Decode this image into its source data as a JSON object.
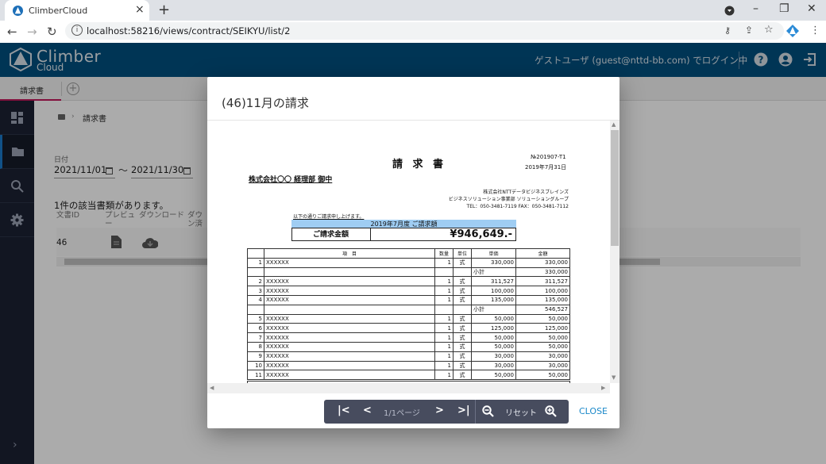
{
  "browser": {
    "tab_title": "ClimberCloud",
    "new_tab": "+",
    "url": "localhost:58216/views/contract/SEIKYU/list/2",
    "window_controls": {
      "minimize": "–",
      "restore": "❐",
      "close": "✕"
    }
  },
  "app": {
    "logo_main": "Climber",
    "logo_sub": "Cloud",
    "login_status": "ゲストユーザ (guest@nttd-bb.com) でログイン中",
    "brand_color": "#00507f",
    "header_icons": [
      "help-icon",
      "account-icon",
      "logout-icon"
    ]
  },
  "subnav": {
    "tab_label": "請求書",
    "add_tab": "+"
  },
  "sidebar": {
    "items": [
      {
        "icon": "dashboard-icon",
        "active": false
      },
      {
        "icon": "folder-icon",
        "active": true
      },
      {
        "icon": "search-icon",
        "active": false
      },
      {
        "icon": "settings-icon",
        "active": false
      }
    ],
    "expand": "›"
  },
  "main": {
    "breadcrumb": {
      "sep": "›",
      "label": "請求書"
    },
    "date_filter": {
      "label": "日付",
      "from": "2021/11/01",
      "tilde": "〜",
      "to": "2021/11/30"
    },
    "result_count": "1件の該当書類があります。",
    "columns": [
      "文書ID",
      "プレビュー",
      "ダウンロード",
      "ダウン済み"
    ],
    "rows": [
      {
        "id": "46"
      }
    ]
  },
  "modal": {
    "title": "(46)11月の請求",
    "toolbar": {
      "first": "|<",
      "prev": "<",
      "page_info": "1/1ページ",
      "next": ">",
      "last": ">|",
      "reset": "リセット"
    },
    "close_label": "CLOSE"
  },
  "document": {
    "title": "請 求 書",
    "number": "№201907-T1",
    "date": "2019年7月31日",
    "addressee": "株式会社〇〇 経理部 御中",
    "sender": [
      "株式会社NTTデータビジネスブレインズ",
      "ビジネスソリューション事業部 ソリューショングループ",
      "TEL：050-3481-7119 FAX：050-3481-7112"
    ],
    "intro": "以下の通りご請求申し上げます。",
    "amount_header": "2019年7月度 ご請求額",
    "amount_label": "ご請求金額",
    "amount_value": "¥946,649.-",
    "table_headers": [
      "",
      "項　目",
      "数量",
      "単位",
      "単価",
      "金額"
    ],
    "rows": [
      [
        "1",
        "XXXXXX",
        "1",
        "式",
        "330,000",
        "330,000"
      ],
      [
        "",
        "",
        "",
        "",
        "小計",
        "330,000"
      ],
      [
        "2",
        "XXXXXX",
        "1",
        "式",
        "311,527",
        "311,527"
      ],
      [
        "3",
        "XXXXXX",
        "1",
        "式",
        "100,000",
        "100,000"
      ],
      [
        "4",
        "XXXXXX",
        "1",
        "式",
        "135,000",
        "135,000"
      ],
      [
        "",
        "",
        "",
        "",
        "小計",
        "546,527"
      ],
      [
        "5",
        "XXXXXX",
        "1",
        "式",
        "50,000",
        "50,000"
      ],
      [
        "6",
        "XXXXXX",
        "1",
        "式",
        "125,000",
        "125,000"
      ],
      [
        "7",
        "XXXXXX",
        "1",
        "式",
        "50,000",
        "50,000"
      ],
      [
        "8",
        "XXXXXX",
        "1",
        "式",
        "50,000",
        "50,000"
      ],
      [
        "9",
        "XXXXXX",
        "1",
        "式",
        "30,000",
        "30,000"
      ],
      [
        "10",
        "XXXXXX",
        "1",
        "式",
        "30,000",
        "30,000"
      ],
      [
        "11",
        "XXXXXX",
        "1",
        "式",
        "50,000",
        "50,000"
      ]
    ]
  }
}
